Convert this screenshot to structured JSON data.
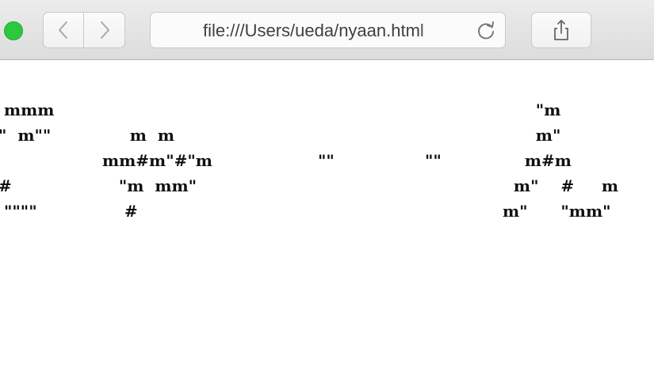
{
  "browser": {
    "url": "file:///Users/ueda/nyaan.html",
    "icons": {
      "close": "green-zoom-dot",
      "back": "chevron-left-icon",
      "forward": "chevron-right-icon",
      "reload": "reload-icon",
      "share": "share-icon"
    },
    "colors": {
      "toolbar": "#e3e3e3",
      "zoom_dot": "#2cc840"
    }
  },
  "page": {
    "ascii_art": [
      {
        "lines": " mmm\n\"  m\"\"\n\n#\n \"\"\"\""
      },
      {
        "lines": "      m  m\n mm#m\"#\"m\n    \"m  mm\"\n     #"
      },
      {
        "lines": "\"\""
      },
      {
        "lines": "\"\""
      },
      {
        "lines": "      \"m\n      m\"\n    m#m\n  m\"    #     m\nm\"      \"mm\""
      }
    ]
  }
}
